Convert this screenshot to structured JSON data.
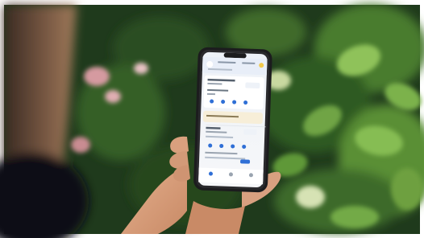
{
  "scene": {
    "description_type": "photograph",
    "subject": "hand-holding-smartphone",
    "background": "blurred-green-foliage",
    "colors": {
      "foliage_dark": "#1f3a1c",
      "foliage_mid": "#3f6b2c",
      "foliage_light": "#8fc25a",
      "wall_left": "#6a4f3a",
      "skin": "#d9a07e",
      "phone_frame": "#1c1c1e",
      "screen_bg": "#f2f4f7",
      "accent": "#2f6fd6"
    }
  },
  "phone_app": {
    "header": {},
    "tabs": [
      {},
      {},
      {}
    ],
    "cards": [
      {},
      {}
    ],
    "bottom_nav": [
      {},
      {},
      {}
    ]
  }
}
